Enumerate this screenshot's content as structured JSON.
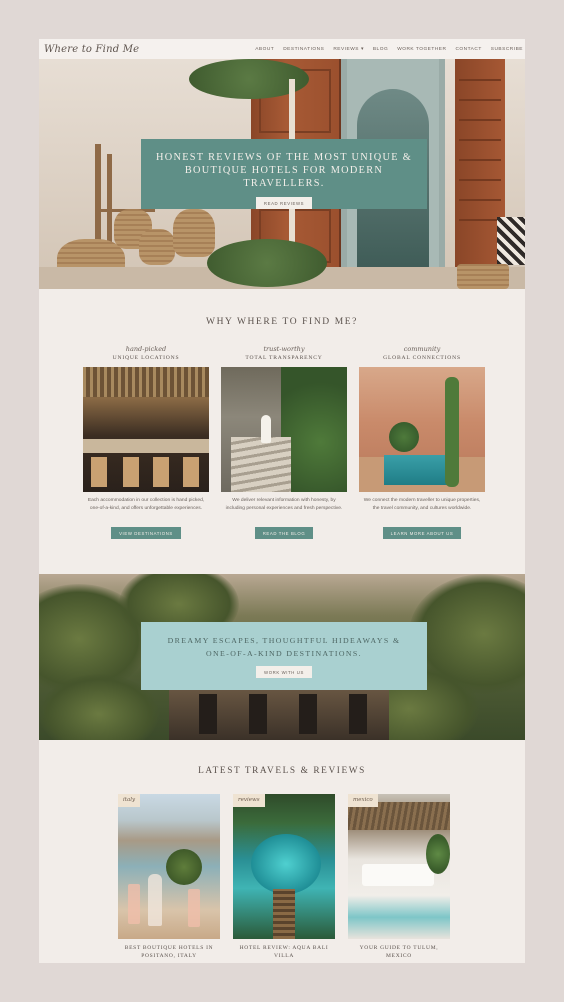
{
  "header": {
    "logo": "Where to Find Me",
    "nav": [
      "ABOUT",
      "DESTINATIONS",
      "REVIEWS",
      "BLOG",
      "WORK TOGETHER",
      "CONTACT",
      "SUBSCRIBE"
    ]
  },
  "hero": {
    "title_line1": "HONEST REVIEWS OF THE MOST UNIQUE &",
    "title_line2": "BOUTIQUE HOTELS FOR MODERN TRAVELLERS.",
    "button": "READ REVIEWS"
  },
  "why": {
    "title": "WHY WHERE TO FIND ME?",
    "columns": [
      {
        "script": "hand-picked",
        "label": "UNIQUE LOCATIONS",
        "text": "Each accommodation in our collection is hand picked, one-of-a-kind, and offers unforgettable experiences.",
        "button": "VIEW DESTINATIONS"
      },
      {
        "script": "trust-worthy",
        "label": "TOTAL TRANSPARENCY",
        "text": "We deliver relevant information with honesty, by including personal experiences and fresh perspective.",
        "button": "READ THE BLOG"
      },
      {
        "script": "community",
        "label": "GLOBAL CONNECTIONS",
        "text": "We connect the modern traveller to unique properties, the travel community, and cultures worldwide.",
        "button": "LEARN MORE ABOUT US"
      }
    ]
  },
  "band": {
    "title_line1": "DREAMY ESCAPES, THOUGHTFUL HIDEAWAYS &",
    "title_line2": "ONE-OF-A-KIND DESTINATIONS.",
    "button": "WORK WITH US"
  },
  "latest": {
    "title": "LATEST TRAVELS & REVIEWS",
    "posts": [
      {
        "tag": "italy",
        "title_line1": "BEST BOUTIQUE HOTELS IN",
        "title_line2": "POSITANO, ITALY"
      },
      {
        "tag": "reviews",
        "title_line1": "HOTEL REVIEW: AQUA BALI",
        "title_line2": "VILLA"
      },
      {
        "tag": "mexico",
        "title_line1": "YOUR GUIDE TO TULUM,",
        "title_line2": "MEXICO"
      }
    ]
  },
  "colors": {
    "teal": "#5f8f87",
    "light_teal": "#a9d0d0",
    "page_bg": "#f2ede9",
    "frame": "#e0d8d5"
  }
}
